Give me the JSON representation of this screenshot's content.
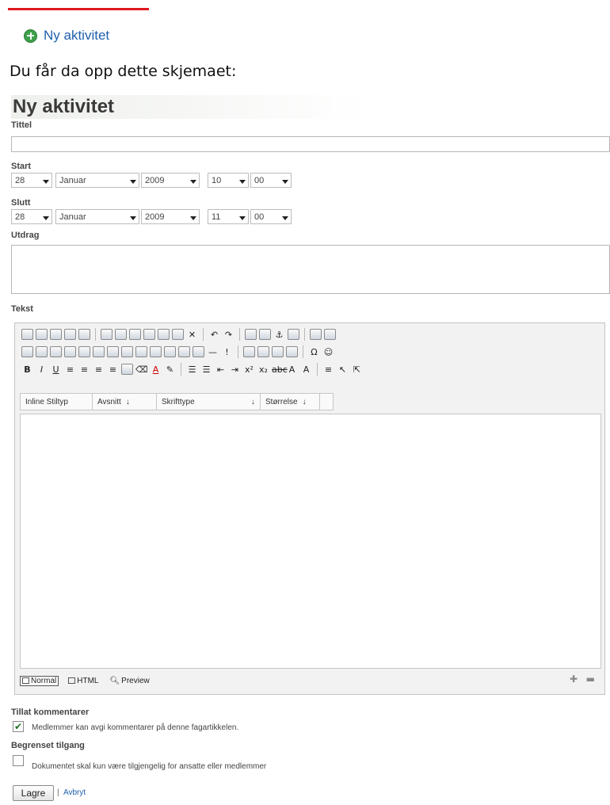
{
  "top_button": {
    "label": "Ny aktivitet"
  },
  "intro": "Du får da opp dette skjemaet:",
  "form": {
    "title": "Ny aktivitet",
    "title_label": "Tittel",
    "title_value": "",
    "start": {
      "label": "Start",
      "day": "28",
      "month": "Januar",
      "year": "2009",
      "hour": "10",
      "minute": "00"
    },
    "end": {
      "label": "Slutt",
      "day": "28",
      "month": "Januar",
      "year": "2009",
      "hour": "11",
      "minute": "00"
    },
    "excerpt_label": "Utdrag",
    "text_label": "Tekst",
    "editor": {
      "style_dropdowns": [
        "Inline Stiltyp",
        "Avsnitt",
        "Skrifttype",
        "Størrelse"
      ],
      "modes": [
        "Normal",
        "HTML",
        "Preview"
      ],
      "active_mode": "Normal"
    },
    "comments": {
      "label": "Tillat kommentarer",
      "checkbox_text": "Medlemmer kan avgi kommentarer på denne fagartikkelen.",
      "checked": true
    },
    "restricted": {
      "label": "Begrenset tilgang",
      "checkbox_text": "Dokumentet skal kun være tilgjengelig for ansatte eller medlemmer",
      "checked": false
    },
    "save_label": "Lagre",
    "separator": "|",
    "cancel_label": "Avbryt"
  },
  "colors": {
    "accent_red": "#e0191f",
    "link_blue": "#1f5fae",
    "plus_green": "#3da24b"
  }
}
